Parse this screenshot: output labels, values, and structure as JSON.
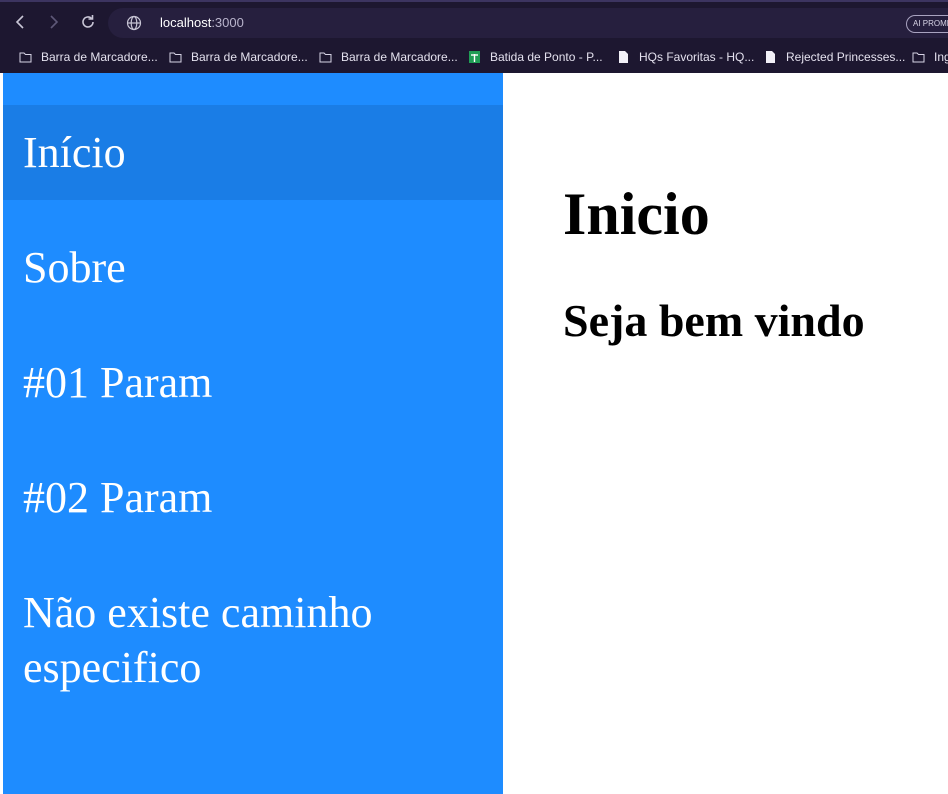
{
  "browser": {
    "url_host": "localhost",
    "url_port": ":3000",
    "ai_badge": "AI PROMPT",
    "bookmarks": [
      {
        "label": "Barra de Marcadore...",
        "icon": "folder-icon"
      },
      {
        "label": "Barra de Marcadore...",
        "icon": "folder-icon"
      },
      {
        "label": "Barra de Marcadore...",
        "icon": "folder-icon"
      },
      {
        "label": "Batida de Ponto - P...",
        "icon": "sheets-icon"
      },
      {
        "label": "HQs Favoritas - HQ...",
        "icon": "document-icon"
      },
      {
        "label": "Rejected Princesses...",
        "icon": "document-icon"
      },
      {
        "label": "Ing",
        "icon": "folder-icon"
      }
    ]
  },
  "sidebar": {
    "items": [
      {
        "label": "Início",
        "active": true
      },
      {
        "label": "Sobre"
      },
      {
        "label": "#01 Param"
      },
      {
        "label": "#02 Param"
      },
      {
        "label": "Não existe caminho especifico"
      }
    ]
  },
  "main": {
    "title": "Inicio",
    "subtitle": "Seja bem vindo"
  },
  "colors": {
    "sidebar_bg": "#1e8cff",
    "sidebar_active": "#1a7de6",
    "chrome_bg": "#1d1730"
  }
}
